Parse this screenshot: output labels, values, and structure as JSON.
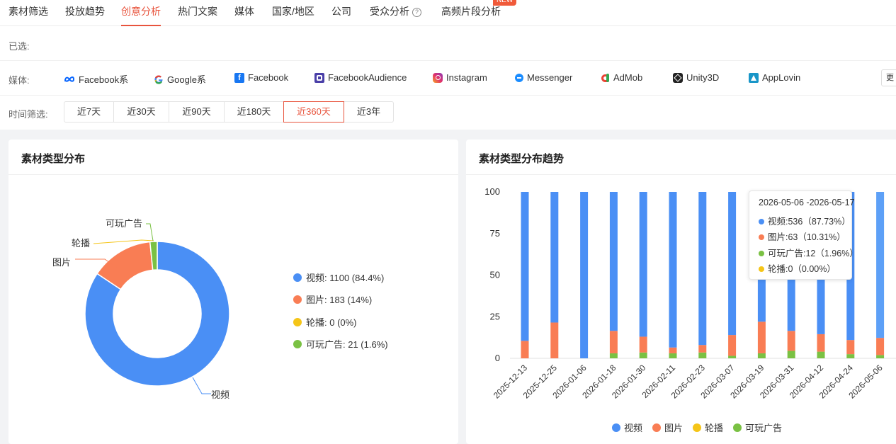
{
  "tabs": [
    {
      "label": "素材筛选",
      "active": false
    },
    {
      "label": "投放趋势",
      "active": false
    },
    {
      "label": "创意分析",
      "active": true
    },
    {
      "label": "热门文案",
      "active": false
    },
    {
      "label": "媒体",
      "active": false
    },
    {
      "label": "国家/地区",
      "active": false
    },
    {
      "label": "公司",
      "active": false
    },
    {
      "label": "受众分析",
      "active": false
    },
    {
      "label": "高频片段分析",
      "active": false
    }
  ],
  "new_badge": "NEW",
  "help_icon_glyph": "?",
  "selected_label": "已选:",
  "media_label": "媒体:",
  "media_items": [
    {
      "label": "Facebook系",
      "icon": "meta-icon"
    },
    {
      "label": "Google系",
      "icon": "google-icon"
    },
    {
      "label": "Facebook",
      "icon": "facebook-icon"
    },
    {
      "label": "FacebookAudience",
      "icon": "facebook-audience-icon"
    },
    {
      "label": "Instagram",
      "icon": "instagram-icon"
    },
    {
      "label": "Messenger",
      "icon": "messenger-icon"
    },
    {
      "label": "AdMob",
      "icon": "admob-icon"
    },
    {
      "label": "Unity3D",
      "icon": "unity-icon"
    },
    {
      "label": "AppLovin",
      "icon": "applovin-icon"
    }
  ],
  "more_label": "更",
  "time_label": "时间筛选:",
  "time_options": [
    {
      "label": "近7天",
      "active": false
    },
    {
      "label": "近30天",
      "active": false
    },
    {
      "label": "近90天",
      "active": false
    },
    {
      "label": "近180天",
      "active": false
    },
    {
      "label": "近360天",
      "active": true
    },
    {
      "label": "近3年",
      "active": false
    }
  ],
  "colors": {
    "accent": "#e8543d",
    "video": "#4a8ff5",
    "image": "#f97d54",
    "carousel": "#f5c518",
    "playable": "#7ac143"
  },
  "chart_data": [
    {
      "type": "pie",
      "title": "素材类型分布",
      "donut": true,
      "slices": [
        {
          "name": "视频",
          "value": 1100,
          "percent": "84.4%",
          "legend": "视频: 1100 (84.4%)"
        },
        {
          "name": "图片",
          "value": 183,
          "percent": "14%",
          "legend": "图片: 183 (14%)"
        },
        {
          "name": "轮播",
          "value": 0,
          "percent": "0%",
          "legend": "轮播: 0 (0%)"
        },
        {
          "name": "可玩广告",
          "value": 21,
          "percent": "1.6%",
          "legend": "可玩广告: 21 (1.6%)"
        }
      ],
      "legend_position": "right"
    },
    {
      "type": "bar",
      "stacked": true,
      "title": "素材类型分布趋势",
      "categories": [
        "2025-12-13",
        "2025-12-25",
        "2026-01-06",
        "2026-01-18",
        "2026-01-30",
        "2026-02-11",
        "2026-02-23",
        "2026-03-07",
        "2026-03-19",
        "2026-03-31",
        "2026-04-12",
        "2026-04-24",
        "2026-05-06"
      ],
      "series": [
        {
          "name": "视频",
          "values": [
            89.5,
            78.5,
            100,
            83.5,
            87,
            93.5,
            92,
            86,
            78,
            83.5,
            85.5,
            89,
            87.73
          ]
        },
        {
          "name": "图片",
          "values": [
            10.5,
            21.5,
            0,
            13.5,
            9.5,
            3.5,
            4.5,
            12.5,
            19,
            12,
            10.5,
            8.5,
            10.31
          ]
        },
        {
          "name": "轮播",
          "values": [
            0,
            0,
            0,
            0,
            0,
            0,
            0,
            0,
            0,
            0,
            0,
            0,
            0
          ]
        },
        {
          "name": "可玩广告",
          "values": [
            0,
            0,
            0,
            3,
            3.5,
            3,
            3.5,
            1.5,
            3,
            4.5,
            4,
            2.5,
            1.96
          ]
        }
      ],
      "yticks": [
        "100",
        "75",
        "50",
        "25",
        "0"
      ],
      "ylim": [
        0,
        100
      ],
      "legend_position": "bottom",
      "tooltip": {
        "range": "2026-05-06 -2026-05-17",
        "lines": [
          "视频:536（87.73%）",
          "图片:63（10.31%）",
          "可玩广告:12（1.96%）",
          "轮播:0（0.00%）"
        ]
      }
    }
  ]
}
